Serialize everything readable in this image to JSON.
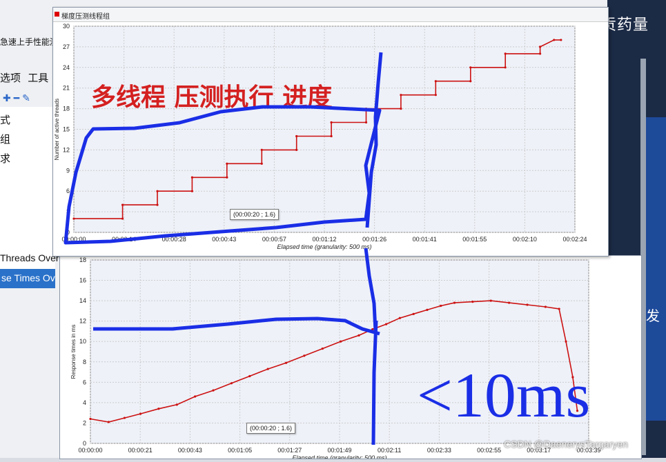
{
  "background_app": {
    "menu_strip": "急速上手性能测试",
    "menu_items": [
      "选项",
      "工具"
    ],
    "toolbar_icons": [
      "add-icon",
      "remove-icon",
      "wand-icon"
    ],
    "tree_items": [
      "式",
      "组",
      "求",
      "Threads Over"
    ],
    "tree_selected": "se Times Ov"
  },
  "right_panel": {
    "title": "华贡药量",
    "side_char": "发"
  },
  "window_top": {
    "title": "梯度压测线程组",
    "tooltip": "(00:00:20 ; 1.6)"
  },
  "window_bottom": {
    "tooltip": "(00:00:20 ; 1.6)"
  },
  "annotations": {
    "banner": "多线程 压测执行 进度",
    "note": "<10ms",
    "watermark": "CSDN @DaenerysTargaryen"
  },
  "chart_data": [
    {
      "type": "line",
      "title": "",
      "xlabel": "Elapsed time (granularity: 500 ms)",
      "ylabel": "Number of active threads",
      "x_ticks": [
        "00:00:00",
        "00:00:14",
        "00:00:28",
        "00:00:43",
        "00:00:57",
        "00:01:12",
        "00:01:26",
        "00:01:41",
        "00:01:55",
        "00:02:10",
        "00:02:24"
      ],
      "y_ticks": [
        0,
        3,
        6,
        9,
        12,
        15,
        18,
        21,
        24,
        27,
        30
      ],
      "ylim": [
        0,
        30
      ],
      "xlim_seconds": [
        0,
        144
      ],
      "series": [
        {
          "points": [
            [
              0,
              2
            ],
            [
              14,
              2
            ],
            [
              14,
              4
            ],
            [
              24,
              4
            ],
            [
              24,
              6
            ],
            [
              34,
              6
            ],
            [
              34,
              8
            ],
            [
              44,
              8
            ],
            [
              44,
              10
            ],
            [
              54,
              10
            ],
            [
              54,
              12
            ],
            [
              64,
              12
            ],
            [
              64,
              14
            ],
            [
              74,
              14
            ],
            [
              74,
              16
            ],
            [
              84,
              16
            ],
            [
              84,
              18
            ],
            [
              94,
              18
            ],
            [
              94,
              20
            ],
            [
              104,
              20
            ],
            [
              104,
              22
            ],
            [
              114,
              22
            ],
            [
              114,
              24
            ],
            [
              124,
              24
            ],
            [
              124,
              26
            ],
            [
              134,
              26
            ],
            [
              134,
              27
            ],
            [
              138,
              28
            ],
            [
              140,
              28
            ]
          ],
          "color": "#cc1111"
        }
      ],
      "grid": true
    },
    {
      "type": "line",
      "title": "",
      "xlabel": "Elapsed time (granularity: 500 ms)",
      "ylabel": "Response times in ms",
      "x_ticks": [
        "00:00:00",
        "00:00:21",
        "00:00:43",
        "00:01:05",
        "00:01:27",
        "00:01:49",
        "00:02:11",
        "00:02:33",
        "00:02:55",
        "00:03:17",
        "00:03:39"
      ],
      "y_ticks": [
        0,
        2,
        4,
        6,
        8,
        10,
        12,
        14,
        16,
        18
      ],
      "ylim": [
        0,
        18
      ],
      "xlim_seconds": [
        0,
        219
      ],
      "series": [
        {
          "points": [
            [
              0,
              2.4
            ],
            [
              8,
              2.1
            ],
            [
              15,
              2.5
            ],
            [
              22,
              2.9
            ],
            [
              30,
              3.4
            ],
            [
              38,
              3.8
            ],
            [
              46,
              4.6
            ],
            [
              54,
              5.2
            ],
            [
              62,
              5.9
            ],
            [
              70,
              6.6
            ],
            [
              78,
              7.3
            ],
            [
              86,
              7.9
            ],
            [
              94,
              8.6
            ],
            [
              102,
              9.3
            ],
            [
              110,
              10.0
            ],
            [
              118,
              10.6
            ],
            [
              124,
              11.2
            ],
            [
              130,
              11.7
            ],
            [
              136,
              12.3
            ],
            [
              142,
              12.7
            ],
            [
              148,
              13.1
            ],
            [
              154,
              13.5
            ],
            [
              160,
              13.8
            ],
            [
              168,
              13.9
            ],
            [
              176,
              14.0
            ],
            [
              184,
              13.8
            ],
            [
              192,
              13.6
            ],
            [
              200,
              13.4
            ],
            [
              206,
              13.2
            ],
            [
              209,
              10.0
            ],
            [
              212,
              6.5
            ],
            [
              214,
              3.2
            ]
          ],
          "color": "#cc1111"
        }
      ],
      "grid": true
    }
  ]
}
